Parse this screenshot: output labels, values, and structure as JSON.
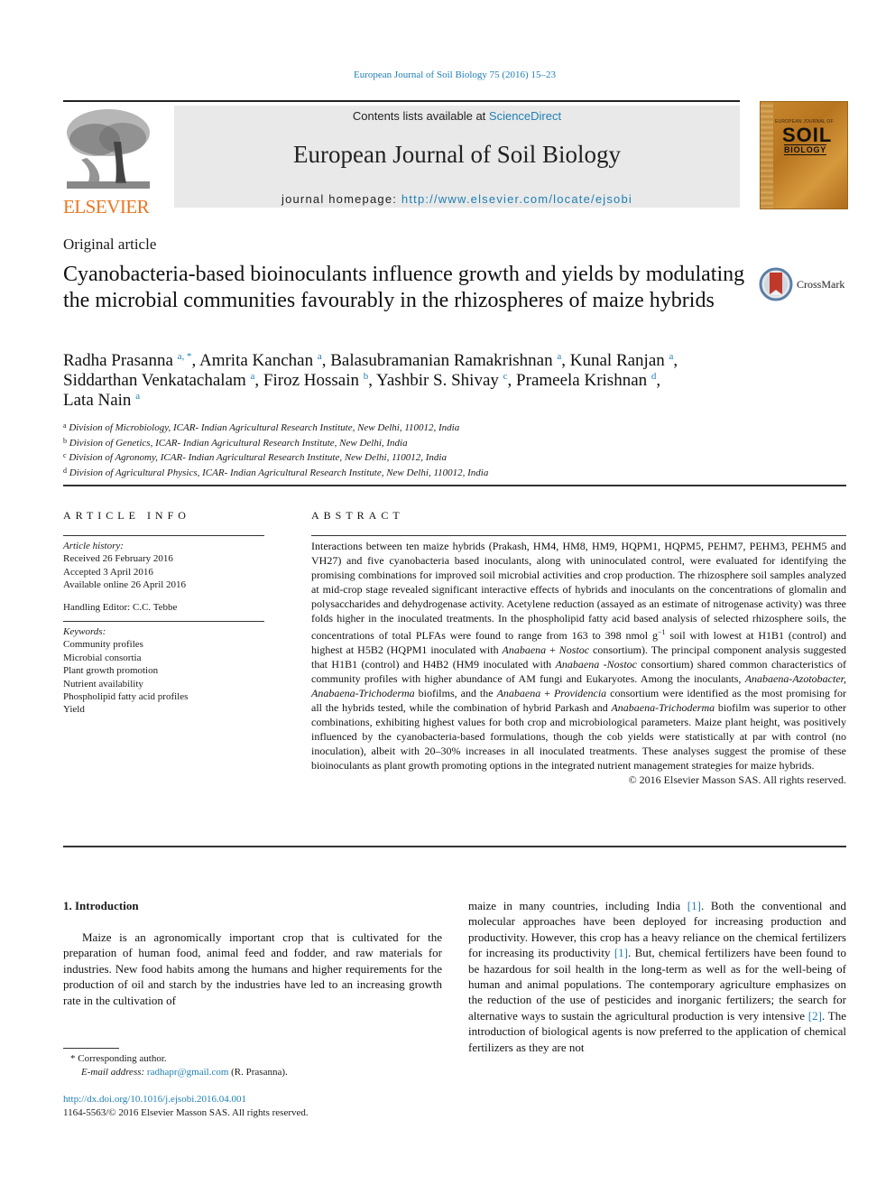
{
  "header": {
    "citation": "European Journal of Soil Biology 75 (2016) 15–23",
    "contents_prefix": "Contents lists available at ",
    "contents_link": "ScienceDirect",
    "journal_name": "European Journal of Soil Biology",
    "homepage_prefix": "journal homepage: ",
    "homepage_link": "http://www.elsevier.com/locate/ejsobi",
    "publisher_logo_text": "ELSEVIER",
    "cover": {
      "top_label": "EUROPEAN JOURNAL OF",
      "title_big": "SOIL",
      "title_small": "BIOLOGY"
    },
    "colors": {
      "link": "#1f7fb4",
      "elsevier_orange": "#e87722",
      "banner_bg": "#e9e9e9"
    }
  },
  "article": {
    "type": "Original article",
    "title": "Cyanobacteria-based bioinoculants influence growth and yields by modulating the microbial communities favourably in the rhizospheres of maize hybrids",
    "crossmark_label": "CrossMark",
    "authors": [
      {
        "name": "Radha Prasanna",
        "sup": "a, *",
        "sep": ", "
      },
      {
        "name": "Amrita Kanchan",
        "sup": "a",
        "sep": ", "
      },
      {
        "name": "Balasubramanian Ramakrishnan",
        "sup": "a",
        "sep": ", "
      },
      {
        "name": "Kunal Ranjan",
        "sup": "a",
        "sep": ", "
      },
      {
        "name": "Siddarthan Venkatachalam",
        "sup": "a",
        "sep": ", "
      },
      {
        "name": "Firoz Hossain",
        "sup": "b",
        "sep": ", "
      },
      {
        "name": "Yashbir S. Shivay",
        "sup": "c",
        "sep": ", "
      },
      {
        "name": "Prameela Krishnan",
        "sup": "d",
        "sep": ", "
      },
      {
        "name": "Lata Nain",
        "sup": "a",
        "sep": ""
      }
    ],
    "affiliations": [
      {
        "sup": "a",
        "text": "Division of Microbiology, ICAR- Indian Agricultural Research Institute, New Delhi, 110012, India"
      },
      {
        "sup": "b",
        "text": "Division of Genetics, ICAR- Indian Agricultural Research Institute, New Delhi, India"
      },
      {
        "sup": "c",
        "text": "Division of Agronomy, ICAR- Indian Agricultural Research Institute, New Delhi, 110012, India"
      },
      {
        "sup": "d",
        "text": "Division of Agricultural Physics, ICAR- Indian Agricultural Research Institute, New Delhi, 110012, India"
      }
    ]
  },
  "article_info": {
    "heading": "ARTICLE INFO",
    "history_label": "Article history:",
    "received": "Received 26 February 2016",
    "accepted": "Accepted 3 April 2016",
    "online": "Available online 26 April 2016",
    "editor": "Handling Editor: C.C. Tebbe",
    "keywords_label": "Keywords:",
    "keywords": [
      "Community profiles",
      "Microbial consortia",
      "Plant growth promotion",
      "Nutrient availability",
      "Phospholipid fatty acid profiles",
      "Yield"
    ]
  },
  "abstract": {
    "heading": "ABSTRACT",
    "segments": [
      {
        "t": "Interactions between ten maize hybrids (Prakash, HM4, HM8, HM9, HQPM1, HQPM5, PEHM7, PEHM3, PEHM5 and VH27) and five cyanobacteria based inoculants, along with uninoculated control, were evaluated for identifying the promising combinations for improved soil microbial activities and crop production. The rhizosphere soil samples analyzed at mid-crop stage revealed significant interactive effects of hybrids and inoculants on the concentrations of glomalin and polysaccharides and dehydrogenase activity. Acetylene reduction (assayed as an estimate of nitrogenase activity) was three folds higher in the inoculated treatments. In the phospholipid fatty acid based analysis of selected rhizosphere soils, the concentrations of total PLFAs were found to range from 163 to 398 nmol g",
        "i": false
      },
      {
        "t": "−1",
        "sup": true
      },
      {
        "t": " soil with lowest at H1B1 (control) and highest at H5B2 (HQPM1 inoculated with ",
        "i": false
      },
      {
        "t": "Anabaena",
        "i": true
      },
      {
        "t": " + ",
        "i": false
      },
      {
        "t": "Nostoc",
        "i": true
      },
      {
        "t": " consortium). The principal component analysis suggested that H1B1 (control) and H4B2 (HM9 inoculated with ",
        "i": false
      },
      {
        "t": "Anabaena -Nostoc",
        "i": true
      },
      {
        "t": " consortium) shared common characteristics of community profiles with higher abundance of AM fungi and Eukaryotes. Among the inoculants, ",
        "i": false
      },
      {
        "t": "Anabaena-Azotobacter, Anabaena-Trichoderma",
        "i": true
      },
      {
        "t": " biofilms, and the ",
        "i": false
      },
      {
        "t": "Anabaena",
        "i": true
      },
      {
        "t": " + ",
        "i": false
      },
      {
        "t": "Providencia",
        "i": true
      },
      {
        "t": " consortium were identified as the most promising for all the hybrids tested, while the combination of hybrid Parkash and ",
        "i": false
      },
      {
        "t": "Anabaena-Trichoderma",
        "i": true
      },
      {
        "t": " biofilm was superior to other combinations, exhibiting highest values for both crop and microbiological parameters. Maize plant height, was positively influenced by the cyanobacteria-based formulations, though the cob yields were statistically at par with control (no inoculation), albeit with 20–30% increases in all inoculated treatments. These analyses suggest the promise of these bioinoculants as plant growth promoting options in the integrated nutrient management strategies for maize hybrids.",
        "i": false
      }
    ],
    "copyright": "© 2016 Elsevier Masson SAS. All rights reserved."
  },
  "introduction": {
    "heading": "1.  Introduction",
    "left_text": "Maize is an agronomically important crop that is cultivated for the preparation of human food, animal feed and fodder, and raw materials for industries. New food habits among the humans and higher requirements for the production of oil and starch by the industries have led to an increasing growth rate in the cultivation of",
    "right_segments": [
      {
        "t": "maize in many countries, including India "
      },
      {
        "t": "[1]",
        "ref": true
      },
      {
        "t": ". Both the conventional and molecular approaches have been deployed for increasing production and productivity. However, this crop has a heavy reliance on the chemical fertilizers for increasing its productivity "
      },
      {
        "t": "[1]",
        "ref": true
      },
      {
        "t": ". But, chemical fertilizers have been found to be hazardous for soil health in the long-term as well as for the well-being of human and animal populations. The contemporary agriculture emphasizes on the reduction of the use of pesticides and inorganic fertilizers; the search for alternative ways to sustain the agricultural production is very intensive "
      },
      {
        "t": "[2]",
        "ref": true
      },
      {
        "t": ". The introduction of biological agents is now preferred to the application of chemical fertilizers as they are not"
      }
    ]
  },
  "footnotes": {
    "corresponding_mark": "*",
    "corresponding_text": "Corresponding author.",
    "email_label": "E-mail address:",
    "email": "radhapr@gmail.com",
    "email_suffix": " (R. Prasanna).",
    "doi": "http://dx.doi.org/10.1016/j.ejsobi.2016.04.001",
    "issn_line": "1164-5563/© 2016 Elsevier Masson SAS. All rights reserved."
  }
}
